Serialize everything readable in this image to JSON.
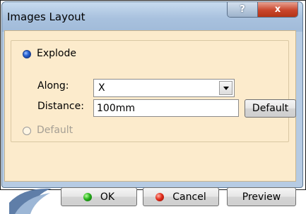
{
  "window": {
    "title": "Images Layout",
    "help_button": "?",
    "close_button": "x"
  },
  "options": {
    "explode_label": "Explode",
    "along_label": "Along:",
    "along_value": "X",
    "distance_label": "Distance:",
    "distance_value": "100mm",
    "default_button": "Default",
    "default_option_label": "Default"
  },
  "footer": {
    "ok_label": "OK",
    "cancel_label": "Cancel",
    "preview_label": "Preview"
  },
  "colors": {
    "panel_bg": "#fcebcc",
    "title_bg": "#a8c1de",
    "close_red": "#c9462c",
    "ok_green": "#27b21b",
    "cancel_red": "#e22d1b"
  }
}
